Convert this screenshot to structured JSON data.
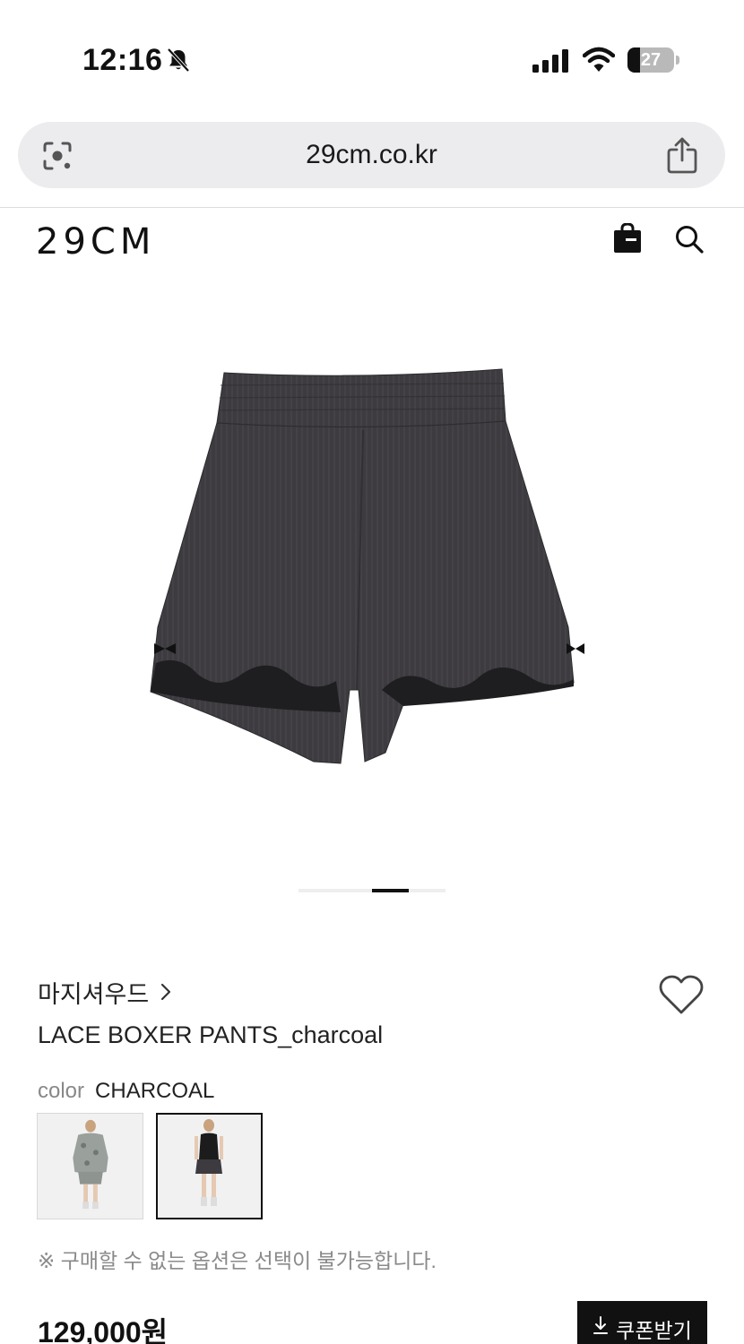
{
  "status_bar": {
    "time": "12:16",
    "battery_level": "27",
    "battery_fraction": 0.27,
    "icons": [
      "bell-slash-icon",
      "signal-icon",
      "wifi-icon",
      "battery-icon"
    ]
  },
  "browser": {
    "url": "29cm.co.kr",
    "icons": [
      "lens-icon",
      "share-icon"
    ]
  },
  "header": {
    "logo": "29CM",
    "icons": [
      "shopping-bag-icon",
      "search-icon"
    ]
  },
  "gallery": {
    "image_subject": "charcoal lace boxer shorts",
    "current_slide": 3,
    "total_slides": 4
  },
  "product": {
    "brand": "마지셔우드",
    "name": "LACE BOXER PANTS_charcoal",
    "color_label": "color",
    "color_value": "CHARCOAL",
    "swatches": [
      "floral-print",
      "charcoal"
    ],
    "selected_swatch": "charcoal",
    "notice": "※ 구매할 수 없는 옵션은 선택이 불가능합니다.",
    "price": "129,000원",
    "coupon_label": "쿠폰받기"
  },
  "colors": {
    "text": "#111111",
    "muted": "#888888",
    "url_bar_bg": "#ececee",
    "button_bg": "#111111",
    "product_charcoal": "#3d3b3f"
  }
}
